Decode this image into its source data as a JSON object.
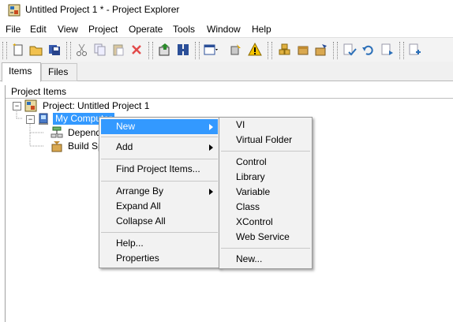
{
  "window": {
    "title": "Untitled Project 1 * - Project Explorer"
  },
  "menubar": [
    "File",
    "Edit",
    "View",
    "Project",
    "Operate",
    "Tools",
    "Window",
    "Help"
  ],
  "toolbar": {
    "icons": [
      "new-icon",
      "open-icon",
      "save-all-icon",
      "cut-icon",
      "copy-icon",
      "paste-icon",
      "delete-icon",
      "deploy-icon",
      "build-icon",
      "view-menu-icon",
      "settings-icon",
      "warning-icon",
      "add-items-icon",
      "package-icon",
      "build-spec-icon",
      "check-icon",
      "undo-icon",
      "redo-icon",
      "add-file-icon"
    ]
  },
  "tabs": [
    "Items",
    "Files"
  ],
  "panel": {
    "header": "Project Items"
  },
  "tree": {
    "project": "Project: Untitled Project 1",
    "computer": "My Computer",
    "dependencies": "Dependencies",
    "build_specs": "Build Specifications"
  },
  "context_menu": {
    "items": [
      "New",
      "Add",
      "Find Project Items...",
      "Arrange By",
      "Expand All",
      "Collapse All",
      "Help...",
      "Properties"
    ]
  },
  "submenu": {
    "items": [
      "VI",
      "Virtual Folder",
      "Control",
      "Library",
      "Variable",
      "Class",
      "XControl",
      "Web Service",
      "New..."
    ]
  },
  "colors": {
    "highlight": "#3399ff",
    "menu_bg": "#f2f2f2"
  }
}
